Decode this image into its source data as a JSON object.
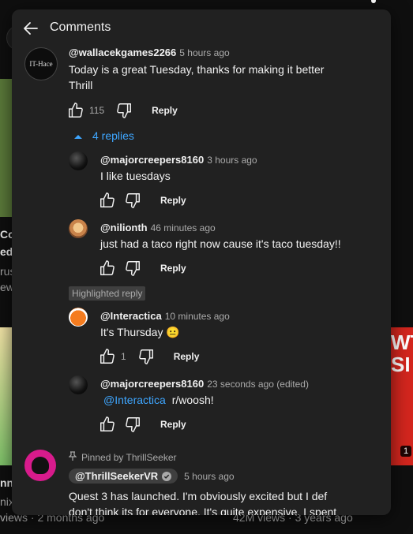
{
  "background": {
    "left_video": {
      "title_line1": "Co",
      "title_line2": "ed",
      "meta1": "rus",
      "meta2": "ew",
      "bottom_title": "nn",
      "bottom_meta1": "nix",
      "bottom_meta2": "views · 2 months ago"
    },
    "right_video": {
      "overlay_text_top": "WT",
      "overlay_text_bottom": "SI",
      "duration": "1",
      "meta": "42M views · 3 years ago"
    }
  },
  "panel": {
    "title": "Comments"
  },
  "comments": [
    {
      "author": "@wallacekgames2266",
      "time": "5 hours ago",
      "text": "Today is a great Tuesday, thanks for making it better Thrill",
      "likes": "115",
      "reply_label": "Reply",
      "avatar_text": "IT-Hace",
      "replies_toggle": "4 replies"
    },
    {
      "author": "@majorcreepers8160",
      "time": "3 hours ago",
      "text": "I like tuesdays",
      "reply_label": "Reply"
    },
    {
      "author": "@nilionth",
      "time": "46 minutes ago",
      "text": "just had a taco right now cause it's taco tuesday!!",
      "reply_label": "Reply"
    },
    {
      "badge": "Highlighted reply",
      "author": "@Interactica",
      "time": "10 minutes ago",
      "text": "It's Thursday 😐",
      "likes": "1",
      "reply_label": "Reply"
    },
    {
      "author": "@majorcreepers8160",
      "time": "23 seconds ago (edited)",
      "mention": "@Interactica",
      "text": "r/woosh!",
      "reply_label": "Reply"
    },
    {
      "pinned_label": "Pinned by ThrillSeeker",
      "author": "@ThrillSeekerVR",
      "time": "5 hours ago",
      "text": "Quest 3 has launched. I'm obviously excited but I def don't think its for everyone. It's quite expensive, I spent"
    }
  ],
  "colors": {
    "panel_bg": "#212121",
    "link_blue": "#3ea6ff",
    "muted_text": "#aaaaaa",
    "primary_text": "#f1f1f1"
  }
}
